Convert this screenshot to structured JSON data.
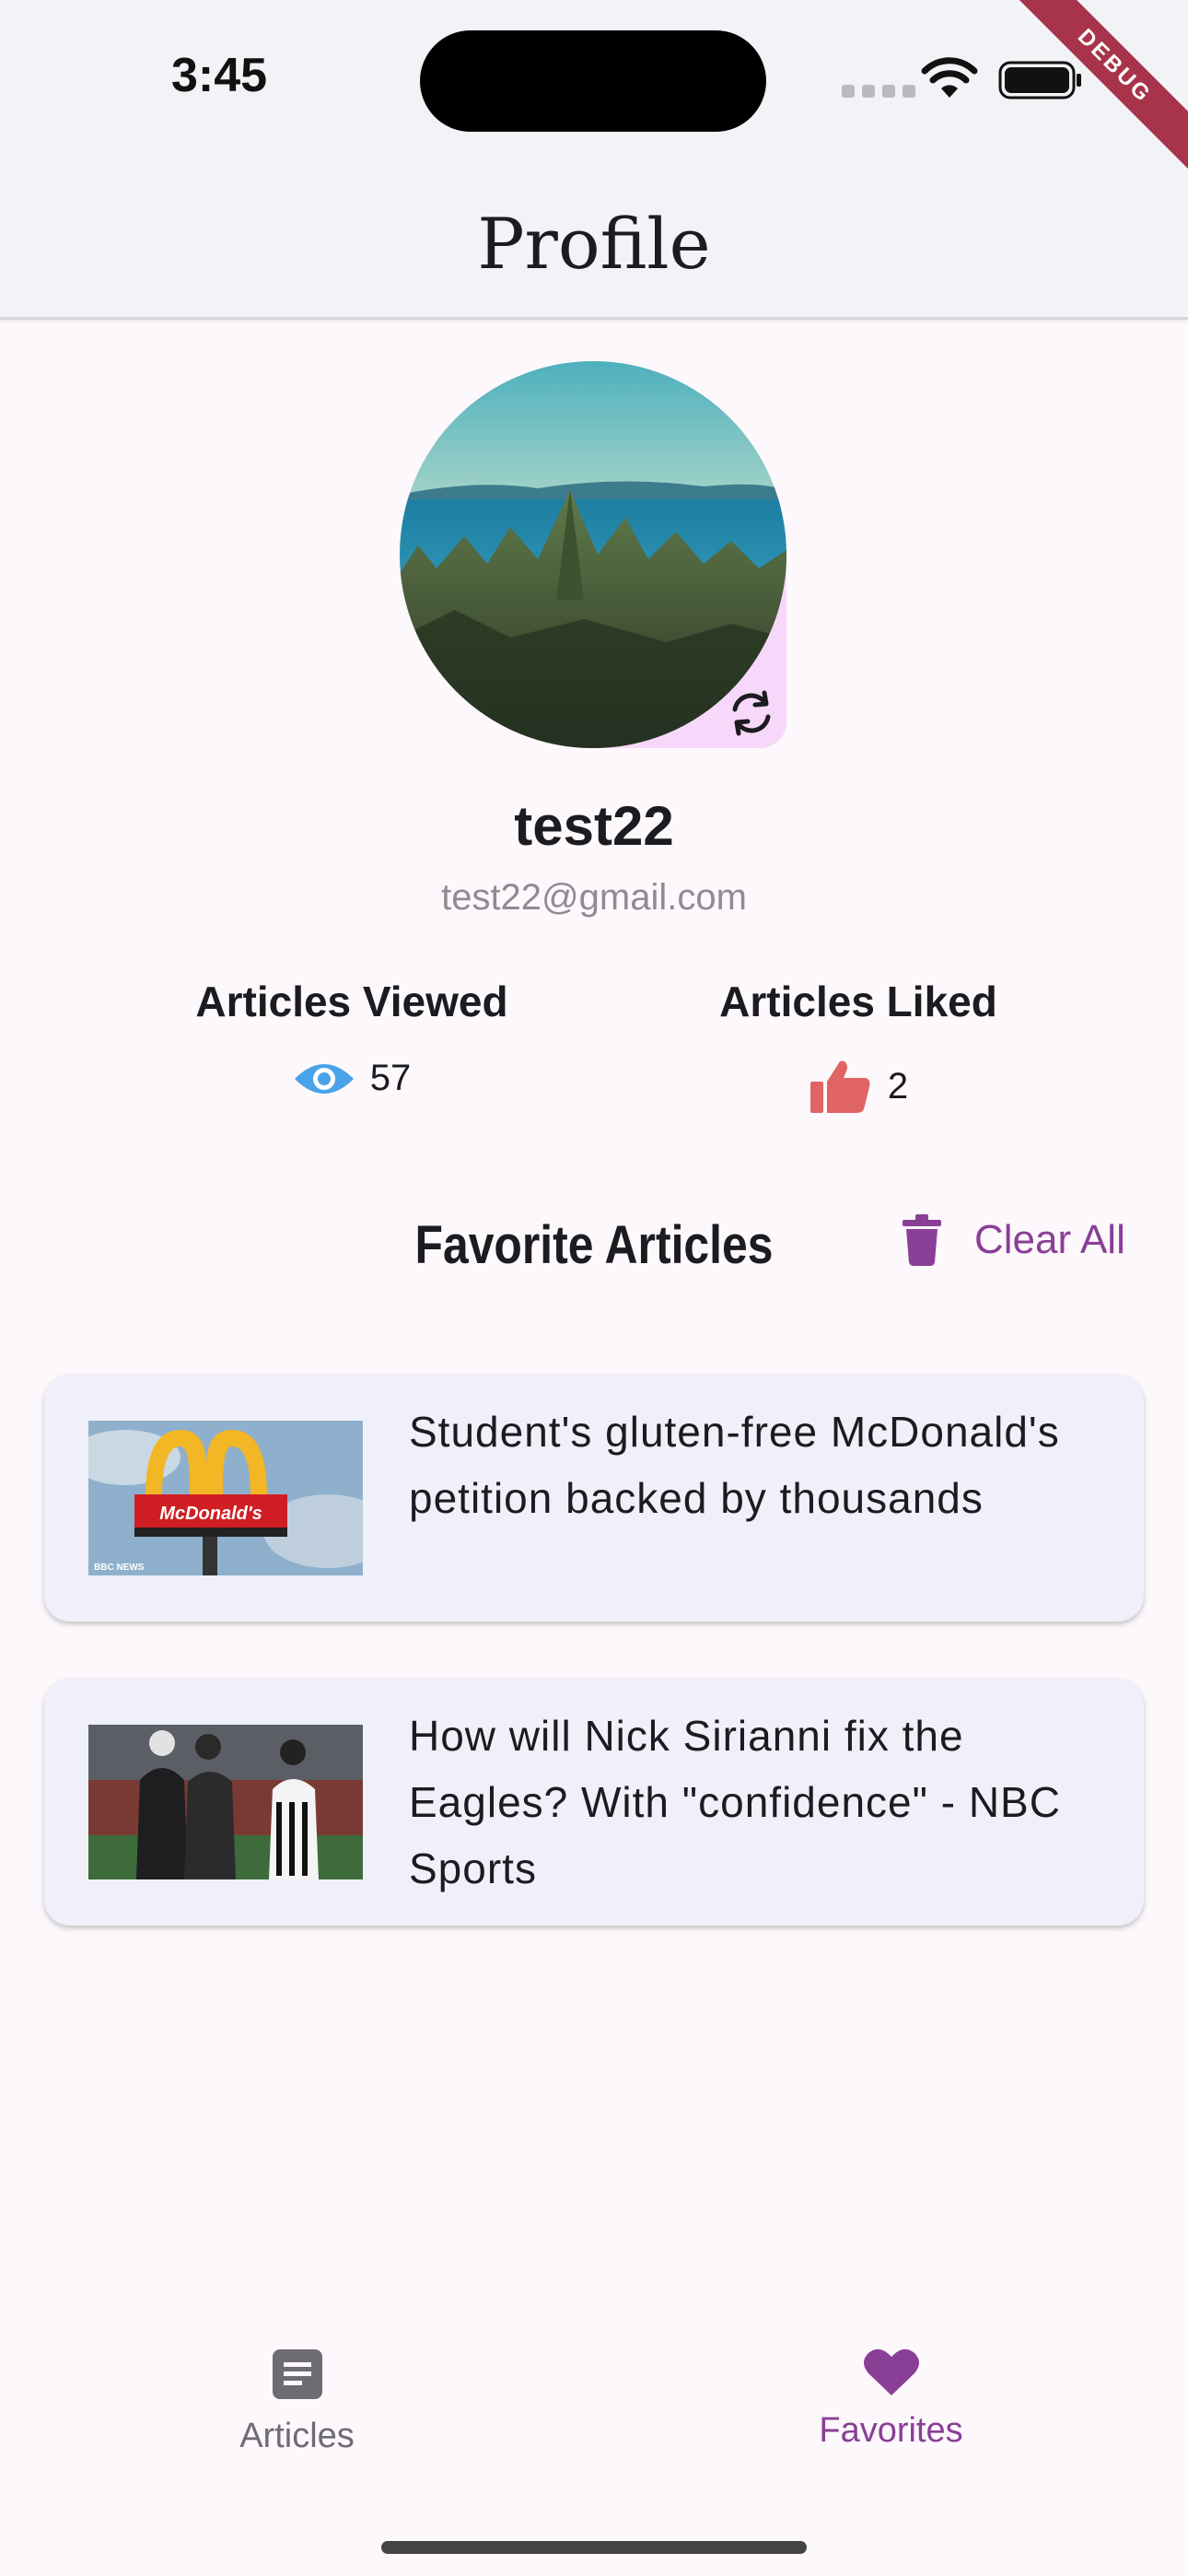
{
  "status_bar": {
    "time": "3:45",
    "debug_label": "DEBUG"
  },
  "app_bar": {
    "title": "Profile"
  },
  "profile": {
    "username": "test22",
    "email": "test22@gmail.com"
  },
  "stats": {
    "viewed": {
      "label": "Articles Viewed",
      "value": "57",
      "icon": "eye-icon",
      "color": "#4aa3e8"
    },
    "liked": {
      "label": "Articles Liked",
      "value": "2",
      "icon": "thumbs-up-icon",
      "color": "#e06464"
    }
  },
  "favorites": {
    "header": "Favorite Articles",
    "clear_all_label": "Clear All",
    "accent": "#8a3f96",
    "articles": [
      {
        "title": "Student's gluten-free McDonald's petition backed by thousands",
        "thumb_text": "McDonald's",
        "thumb_badge": "BBC NEWS"
      },
      {
        "title": "How will Nick Sirianni fix the Eagles? With \"confidence\" - NBC Sports"
      }
    ]
  },
  "bottom_nav": {
    "items": [
      {
        "label": "Articles",
        "icon": "article-icon",
        "active": false
      },
      {
        "label": "Favorites",
        "icon": "heart-icon",
        "active": true
      }
    ],
    "active_color": "#8a3f96",
    "inactive_color": "#6e6b72"
  }
}
